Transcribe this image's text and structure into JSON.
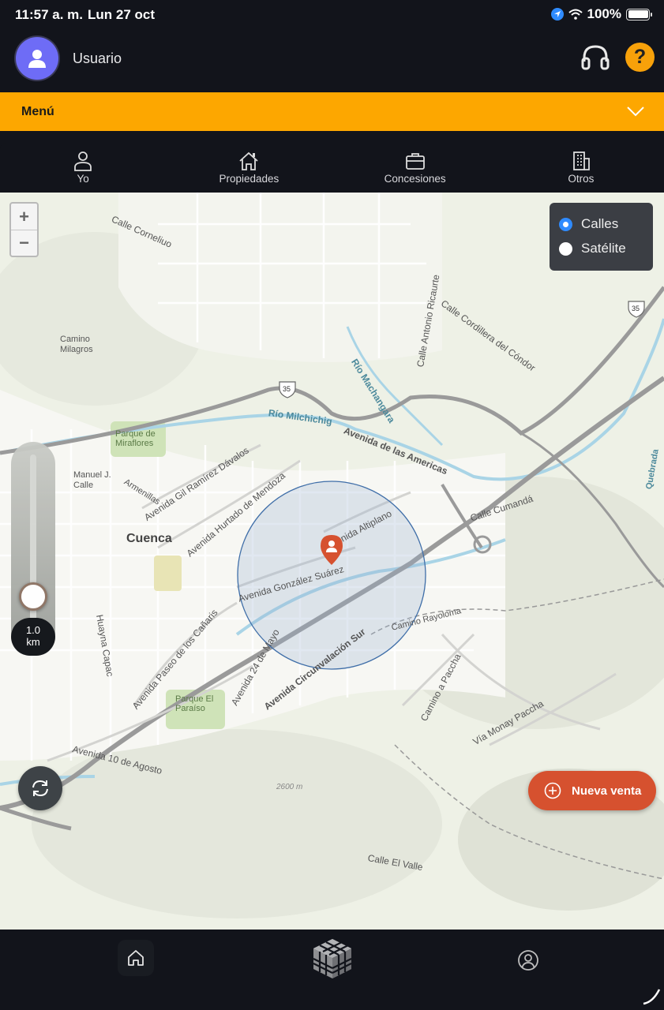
{
  "status_bar": {
    "time": "11:57 a. m.",
    "date": "Lun 27 oct",
    "battery": "100%"
  },
  "header": {
    "username": "Usuario",
    "help_symbol": "?"
  },
  "menu": {
    "label": "Menú"
  },
  "tabs": [
    {
      "label": "Yo",
      "icon": "person-icon"
    },
    {
      "label": "Propiedades",
      "icon": "house-icon"
    },
    {
      "label": "Concesiones",
      "icon": "briefcase-icon"
    },
    {
      "label": "Otros",
      "icon": "building-icon"
    }
  ],
  "map": {
    "zoom_in": "+",
    "zoom_out": "−",
    "layers": [
      {
        "label": "Calles",
        "selected": true
      },
      {
        "label": "Satélite",
        "selected": false
      }
    ],
    "radius": {
      "value": "1.0",
      "unit": "km"
    },
    "labels": {
      "city": "Cuenca",
      "calle_cornelio": "Calle Corneliuo",
      "calle_antonio": "Calle Antonio Ricaurte",
      "calle_cordillera": "Calle Cordillera del Cóndor",
      "rio_machangara": "Río Machangara",
      "rio_milchichig": "Río Milchichig",
      "av_americas": "Avenida de las Americas",
      "av_gil": "Avenida Gil Ramírez Dávalos",
      "av_hurtado": "Avenida Hurtado de Mendoza",
      "av_gonzalez": "Avenida González Suárez",
      "av_altiplano": "Avenida Altiplano",
      "av_circunvalacion": "Avenida Circunvalación Sur",
      "av_24mayo": "Avenida 24 de Mayo",
      "av_paseo": "Avenida Paseo de los Cañaris",
      "av_10agosto": "Avenida 10 de Agosto",
      "huayna": "Huayna Capac",
      "calle_cumanda": "Calle Cumandá",
      "camino_paccha": "Camino a Paccha",
      "via_monay": "Vía Monay Paccha",
      "calle_valle": "Calle El Valle",
      "camino_rayoloma": "Camino Rayoloma",
      "parque_miraflores": "Parque de Miraflores",
      "parque_paraiso": "Parque El Paraíso",
      "manuel_calle": "Manuel J. Calle",
      "armenillas": "Armenillas",
      "elevation": "2600 m",
      "quebrada": "Quebrada",
      "camino_milagros": "Camino Milagros",
      "hwy": "35"
    }
  },
  "fab": {
    "label": "Nueva venta"
  },
  "colors": {
    "accent": "#fda700",
    "fab": "#d6512f",
    "avatar": "#6e6cf6",
    "radio_on": "#2f8bff"
  }
}
